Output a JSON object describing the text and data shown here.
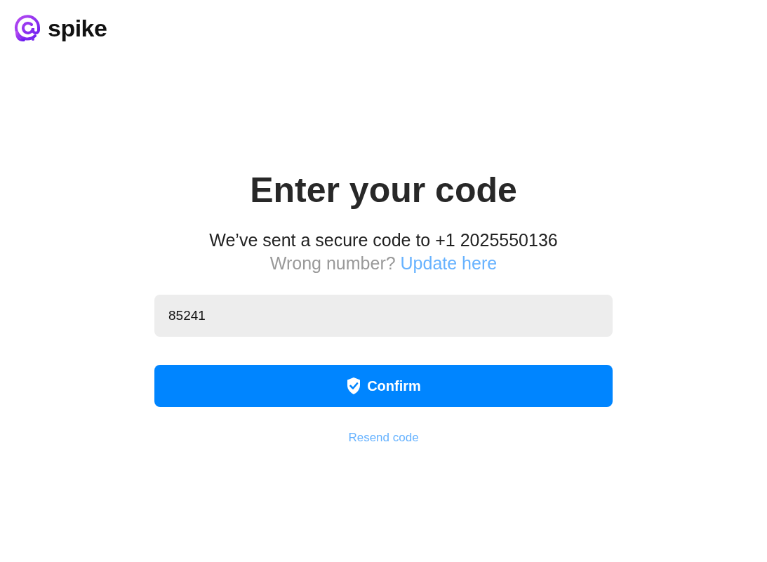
{
  "logo": {
    "text": "spike"
  },
  "heading": "Enter your code",
  "message": "We’ve sent a secure code to +1 2025550136",
  "wrong_number": {
    "question": "Wrong number?",
    "link": "Update here"
  },
  "code_field": {
    "value": "85241"
  },
  "confirm_button": {
    "label": "Confirm"
  },
  "resend_link": "Resend code"
}
